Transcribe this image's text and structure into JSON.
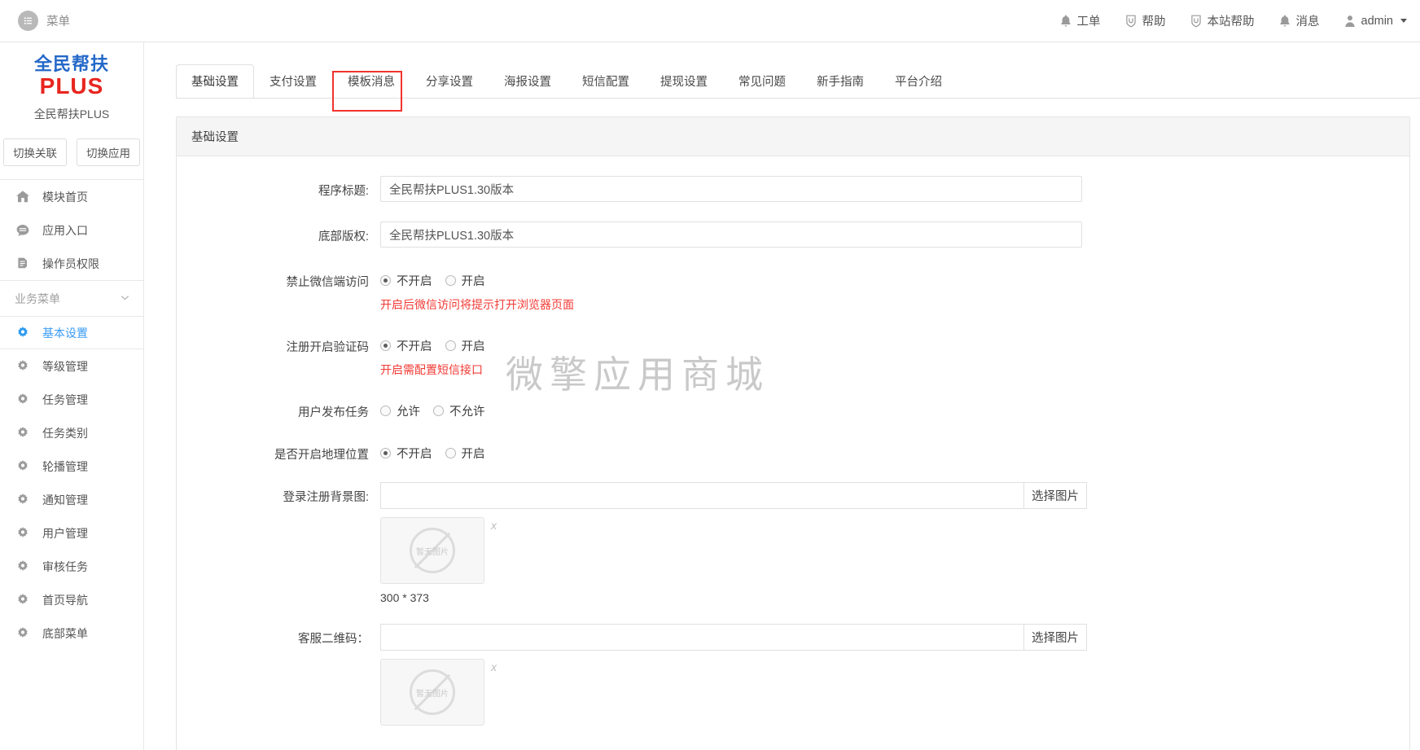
{
  "header": {
    "menu_label": "菜单",
    "menu_icon": "list-menu-icon",
    "items": [
      {
        "label": "工单",
        "icon": "bell-icon"
      },
      {
        "label": "帮助",
        "icon": "shield-icon"
      },
      {
        "label": "本站帮助",
        "icon": "shield-icon"
      },
      {
        "label": "消息",
        "icon": "bell-icon"
      }
    ],
    "user": {
      "label": "admin",
      "icon": "user-icon"
    }
  },
  "sidebar": {
    "logo_line1": "全民帮扶",
    "logo_line2": "PLUS",
    "app_name": "全民帮扶PLUS",
    "buttons": [
      {
        "label": "切换关联"
      },
      {
        "label": "切换应用"
      }
    ],
    "top_items": [
      {
        "label": "模块首页",
        "icon": "home-icon"
      },
      {
        "label": "应用入口",
        "icon": "chat-icon"
      },
      {
        "label": "操作员权限",
        "icon": "document-pen-icon"
      }
    ],
    "group_title": "业务菜单",
    "group_icon": "chevron-down-icon",
    "menu_items": [
      {
        "label": "基本设置",
        "icon": "gear-icon",
        "active": true
      },
      {
        "label": "等级管理",
        "icon": "gear-icon",
        "active": false
      },
      {
        "label": "任务管理",
        "icon": "gear-icon",
        "active": false
      },
      {
        "label": "任务类别",
        "icon": "gear-icon",
        "active": false
      },
      {
        "label": "轮播管理",
        "icon": "gear-icon",
        "active": false
      },
      {
        "label": "通知管理",
        "icon": "gear-icon",
        "active": false
      },
      {
        "label": "用户管理",
        "icon": "gear-icon",
        "active": false
      },
      {
        "label": "审核任务",
        "icon": "gear-icon",
        "active": false
      },
      {
        "label": "首页导航",
        "icon": "gear-icon",
        "active": false
      },
      {
        "label": "底部菜单",
        "icon": "gear-icon",
        "active": false
      }
    ]
  },
  "tabs": [
    {
      "label": "基础设置",
      "active": true
    },
    {
      "label": "支付设置",
      "active": false
    },
    {
      "label": "模板消息",
      "active": false
    },
    {
      "label": "分享设置",
      "active": false
    },
    {
      "label": "海报设置",
      "active": false
    },
    {
      "label": "短信配置",
      "active": false
    },
    {
      "label": "提现设置",
      "active": false
    },
    {
      "label": "常见问题",
      "active": false
    },
    {
      "label": "新手指南",
      "active": false
    },
    {
      "label": "平台介绍",
      "active": false
    }
  ],
  "annotation": {
    "target_tab": "模板消息",
    "color": "#f1342e"
  },
  "panel": {
    "title": "基础设置",
    "watermark": "微擎应用商城",
    "fields": {
      "program_title": {
        "label": "程序标题:",
        "value": "全民帮扶PLUS1.30版本",
        "placeholder": ""
      },
      "footer_copyright": {
        "label": "底部版权:",
        "value": "全民帮扶PLUS1.30版本",
        "placeholder": ""
      },
      "block_wechat": {
        "label": "禁止微信端访问",
        "options": [
          {
            "label": "不开启",
            "checked": true
          },
          {
            "label": "开启",
            "checked": false
          }
        ],
        "hint": "开启后微信访问将提示打开浏览器页面"
      },
      "register_captcha": {
        "label": "注册开启验证码",
        "options": [
          {
            "label": "不开启",
            "checked": true
          },
          {
            "label": "开启",
            "checked": false
          }
        ],
        "hint": "开启需配置短信接口"
      },
      "user_publish_task": {
        "label": "用户发布任务",
        "options": [
          {
            "label": "允许",
            "checked": false
          },
          {
            "label": "不允许",
            "checked": false
          }
        ],
        "hint": ""
      },
      "geo_location": {
        "label": "是否开启地理位置",
        "options": [
          {
            "label": "不开启",
            "checked": true
          },
          {
            "label": "开启",
            "checked": false
          }
        ],
        "hint": ""
      },
      "login_bg_image": {
        "label": "登录注册背景图:",
        "value": "",
        "placeholder": "",
        "button": "选择图片",
        "thumb_text": "暂无图片",
        "remove_label": "x",
        "dimension": "300 * 373"
      },
      "service_qrcode": {
        "label": "客服二维码：",
        "value": "",
        "placeholder": "",
        "button": "选择图片",
        "thumb_text": "暂无图片",
        "remove_label": "x"
      }
    }
  }
}
